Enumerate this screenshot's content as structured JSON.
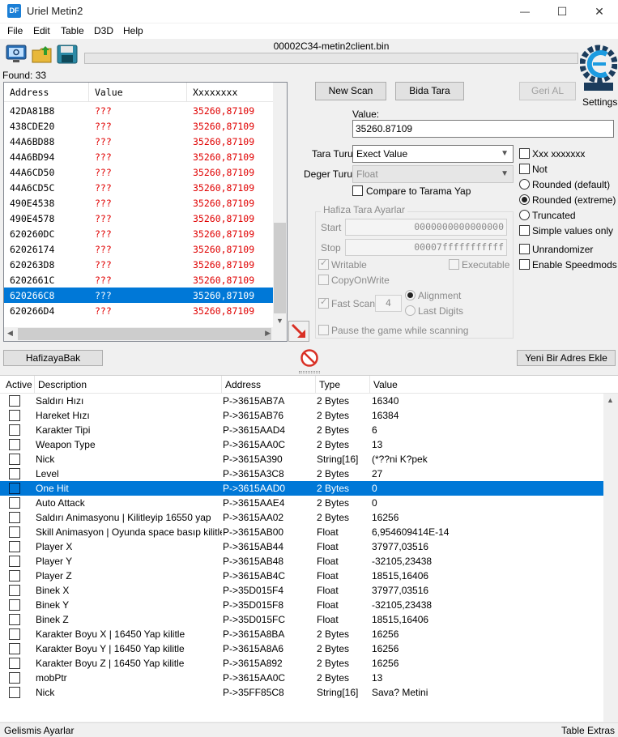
{
  "window": {
    "title": "Uriel Metin2",
    "icon_text": "DF",
    "minimize": "—",
    "maximize": "☐",
    "close": "✕"
  },
  "menu": [
    "File",
    "Edit",
    "Table",
    "D3D",
    "Help"
  ],
  "toolbar": {
    "process_name": "00002C34-metin2client.bin",
    "settings_label": "Settings"
  },
  "found_label": "Found: 33",
  "results": {
    "headers": [
      "Address",
      "Value",
      "Xxxxxxxx"
    ],
    "rows": [
      {
        "address": "42DA81B8",
        "value": "???",
        "previous": "35260,87109"
      },
      {
        "address": "438CDE20",
        "value": "???",
        "previous": "35260,87109"
      },
      {
        "address": "44A6BD88",
        "value": "???",
        "previous": "35260,87109"
      },
      {
        "address": "44A6BD94",
        "value": "???",
        "previous": "35260,87109"
      },
      {
        "address": "44A6CD50",
        "value": "???",
        "previous": "35260,87109"
      },
      {
        "address": "44A6CD5C",
        "value": "???",
        "previous": "35260,87109"
      },
      {
        "address": "490E4538",
        "value": "???",
        "previous": "35260,87109"
      },
      {
        "address": "490E4578",
        "value": "???",
        "previous": "35260,87109"
      },
      {
        "address": "620260DC",
        "value": "???",
        "previous": "35260,87109"
      },
      {
        "address": "62026174",
        "value": "???",
        "previous": "35260,87109"
      },
      {
        "address": "620263D8",
        "value": "???",
        "previous": "35260,87109"
      },
      {
        "address": "6202661C",
        "value": "???",
        "previous": "35260,87109"
      },
      {
        "address": "620266C8",
        "value": "???",
        "previous": "35260,87109"
      },
      {
        "address": "620266D4",
        "value": "???",
        "previous": "35260,87109"
      }
    ],
    "selected_index": 12
  },
  "scan": {
    "new_scan": "New Scan",
    "next_scan": "Bida Tara",
    "undo_scan": "Geri AL",
    "value_label": "Value:",
    "value": "35260.87109",
    "scan_type_label": "Tara Turu",
    "scan_type": "Exect Value",
    "value_type_label": "Deger Turu",
    "value_type": "Float",
    "compare_label": "Compare to Tarama Yap",
    "memory_group_title": "Hafiza Tara Ayarlar",
    "start_label": "Start",
    "start_value": "0000000000000000",
    "stop_label": "Stop",
    "stop_value": "00007fffffffffff",
    "writable": "Writable",
    "executable": "Executable",
    "copy_on_write": "CopyOnWrite",
    "fast_scan": "Fast Scan",
    "fast_scan_value": "4",
    "alignment": "Alignment",
    "last_digits": "Last Digits",
    "pause_game": "Pause the game while scanning"
  },
  "options": {
    "xxx": "Xxx xxxxxxx",
    "not": "Not",
    "rounded_default": "Rounded (default)",
    "rounded_extreme": "Rounded (extreme)",
    "truncated": "Truncated",
    "simple_values": "Simple values only",
    "unrandomizer": "Unrandomizer",
    "speedmods": "Enable Speedmods"
  },
  "bottom_buttons": {
    "memory_view": "HafizayaBak",
    "add_address": "Yeni Bir Adres Ekle"
  },
  "address_table": {
    "headers": [
      "Active",
      "Description",
      "Address",
      "Type",
      "Value"
    ],
    "selected_index": 6,
    "rows": [
      {
        "description": "Saldırı Hızı",
        "address": "P->3615AB7A",
        "type": "2 Bytes",
        "value": "16340"
      },
      {
        "description": "Hareket Hızı",
        "address": "P->3615AB76",
        "type": "2 Bytes",
        "value": "16384"
      },
      {
        "description": "Karakter Tipi",
        "address": "P->3615AAD4",
        "type": "2 Bytes",
        "value": "6"
      },
      {
        "description": "Weapon Type",
        "address": "P->3615AA0C",
        "type": "2 Bytes",
        "value": "13"
      },
      {
        "description": "Nick",
        "address": "P->3615A390",
        "type": "String[16]",
        "value": "(*??ni K?pek"
      },
      {
        "description": "Level",
        "address": "P->3615A3C8",
        "type": "2 Bytes",
        "value": "27"
      },
      {
        "description": "One Hit",
        "address": "P->3615AAD0",
        "type": "2 Bytes",
        "value": "0"
      },
      {
        "description": "Auto Attack",
        "address": "P->3615AAE4",
        "type": "2 Bytes",
        "value": "0"
      },
      {
        "description": "Saldırı Animasyonu | Kilitleyip 16550 yap",
        "address": "P->3615AA02",
        "type": "2 Bytes",
        "value": "16256"
      },
      {
        "description": "Skill Animasyon | Oyunda space basıp kilitle",
        "address": "P->3615AB00",
        "type": "Float",
        "value": "6,954609414E-14"
      },
      {
        "description": "Player X",
        "address": "P->3615AB44",
        "type": "Float",
        "value": "37977,03516"
      },
      {
        "description": "Player Y",
        "address": "P->3615AB48",
        "type": "Float",
        "value": "-32105,23438"
      },
      {
        "description": "Player Z",
        "address": "P->3615AB4C",
        "type": "Float",
        "value": "18515,16406"
      },
      {
        "description": "Binek X",
        "address": "P->35D015F4",
        "type": "Float",
        "value": "37977,03516"
      },
      {
        "description": "Binek Y",
        "address": "P->35D015F8",
        "type": "Float",
        "value": "-32105,23438"
      },
      {
        "description": "Binek Z",
        "address": "P->35D015FC",
        "type": "Float",
        "value": "18515,16406"
      },
      {
        "description": "Karakter Boyu X | 16450 Yap kilitle",
        "address": "P->3615A8BA",
        "type": "2 Bytes",
        "value": "16256"
      },
      {
        "description": "Karakter Boyu Y | 16450 Yap kilitle",
        "address": "P->3615A8A6",
        "type": "2 Bytes",
        "value": "16256"
      },
      {
        "description": "Karakter Boyu Z | 16450 Yap kilitle",
        "address": "P->3615A892",
        "type": "2 Bytes",
        "value": "16256"
      },
      {
        "description": "mobPtr",
        "address": "P->3615AA0C",
        "type": "2 Bytes",
        "value": "13"
      },
      {
        "description": "Nick",
        "address": "P->35FF85C8",
        "type": "String[16]",
        "value": "Sava? Metini"
      }
    ]
  },
  "statusbar": {
    "left": "Gelismis Ayarlar",
    "right": "Table Extras"
  },
  "colors": {
    "selection": "#0078d7",
    "result_value": "#e00000"
  }
}
